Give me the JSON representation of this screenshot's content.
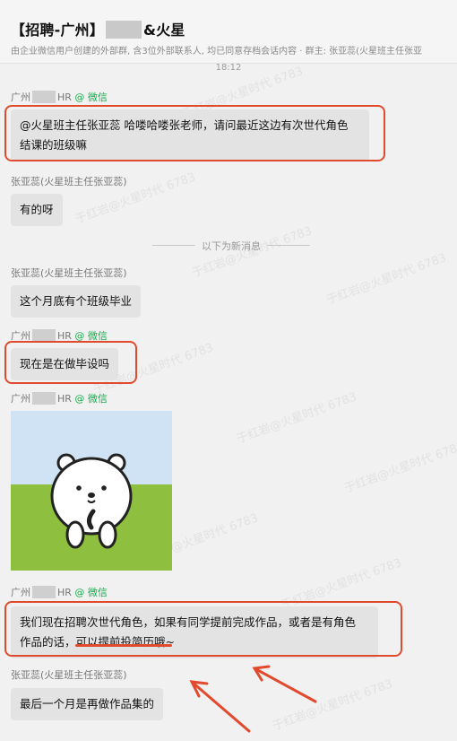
{
  "header": {
    "title_left": "【招聘-广州】",
    "title_right": "&火星",
    "subtitle": "由企业微信用户创建的外部群, 含3位外部联系人, 均已同意存档会话内容 · 群主: 张亚蕊(火星班主任张亚"
  },
  "timestamp": "18:12",
  "unread_divider": "以下为新消息",
  "messages": [
    {
      "sender_prefix": "广州",
      "sender_suffix": "HR",
      "wechat_tag": "@ 微信",
      "text_line1": "@火星班主任张亚蕊 哈喽哈喽张老师，请问最近这边有次世代角色",
      "text_line2": "结课的班级嘛"
    },
    {
      "sender": "张亚蕊(火星班主任张亚蕊)",
      "text": "有的呀"
    },
    {
      "sender": "张亚蕊(火星班主任张亚蕊)",
      "text": "这个月底有个班级毕业"
    },
    {
      "sender_prefix": "广州",
      "sender_suffix": "HR",
      "wechat_tag": "@ 微信",
      "text": "现在是在做毕设吗"
    },
    {
      "sender_prefix": "广州",
      "sender_suffix": "HR",
      "wechat_tag": "@ 微信",
      "sticker": "bear-sticker"
    },
    {
      "sender_prefix": "广州",
      "sender_suffix": "HR",
      "wechat_tag": "@ 微信",
      "text_line1": "我们现在招聘次世代角色，如果有同学提前完成作品，或者是有角色",
      "text_line2": "作品的话，可以提前投简历哦~"
    },
    {
      "sender": "张亚蕊(火星班主任张亚蕊)",
      "text": "最后一个月是再做作品集的"
    }
  ],
  "watermark": "于红岩@火星时代 6783",
  "colors": {
    "annotation": "#e24a2e",
    "wechat": "#14b04a",
    "bubble": "#e3e3e3"
  }
}
